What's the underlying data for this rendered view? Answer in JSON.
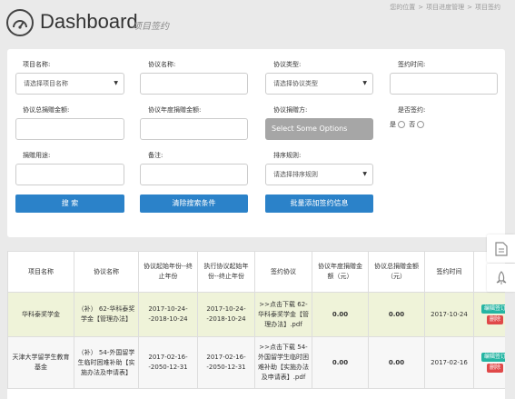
{
  "header": {
    "title": "Dashboard",
    "subtitle": "项目签约",
    "breadcrumb": [
      "您的位置",
      "项目进度管理",
      "项目签约"
    ]
  },
  "search": {
    "fields": {
      "project_name": {
        "label": "项目名称:",
        "placeholder": "请选择项目名称"
      },
      "agreement_name": {
        "label": "协议名称:",
        "value": ""
      },
      "agreement_type": {
        "label": "协议类型:",
        "placeholder": "请选择协议类型"
      },
      "sign_time": {
        "label": "签约时间:",
        "value": ""
      },
      "total_amount": {
        "label": "协议总捐赠金额:",
        "value": ""
      },
      "annual_amount": {
        "label": "协议年度捐赠金额:",
        "value": ""
      },
      "donor": {
        "label": "协议捐赠方:",
        "placeholder": "Select Some Options"
      },
      "signed": {
        "label": "是否签约:",
        "options": [
          "是",
          "否"
        ]
      },
      "usage": {
        "label": "捐赠用途:",
        "value": ""
      },
      "remark": {
        "label": "备注:",
        "value": ""
      },
      "sort_rule": {
        "label": "排序规则:",
        "placeholder": "请选择排序规则"
      }
    },
    "buttons": {
      "search": "搜 索",
      "clear": "清除搜索条件",
      "batch_add": "批量添加签约信息"
    }
  },
  "table": {
    "columns": [
      "项目名称",
      "协议名称",
      "协议起始年份--终止年份",
      "执行协议起始年份--终止年份",
      "签约协议",
      "协议年度捐赠金额（元）",
      "协议总捐赠金额（元）",
      "签约时间",
      "操作"
    ],
    "rows": [
      {
        "project": "华科泰奖学金",
        "agreement": "（补） 62-华科泰奖学金【管理办法】",
        "period": "2017-10-24--2018-10-24",
        "exec_period": "2017-10-24--2018-10-24",
        "file": ">>点击下载 62-华科泰奖学金【管理办法】.pdf",
        "annual": "0.00",
        "total": "0.00",
        "sign_date": "2017-10-24",
        "edit": "编辑签订",
        "delete": "删除"
      },
      {
        "project": "天津大学留学生教育基金",
        "agreement": "（补） 54-外国留学生临时困难补助【实施办法及申请表】",
        "period": "2017-02-16--2050-12-31",
        "exec_period": "2017-02-16--2050-12-31",
        "file": ">>点击下载 54-外国留学生临时困难补助【实施办法及申请表】.pdf",
        "annual": "0.00",
        "total": "0.00",
        "sign_date": "2017-02-16",
        "edit": "编辑签订",
        "delete": "删除"
      }
    ]
  },
  "side_tools": {
    "doc_icon": "document-icon",
    "top_icon": "rocket-icon"
  },
  "colors": {
    "primary": "#2b82c9",
    "edit": "#26b5a3",
    "delete": "#e04949",
    "row_highlight": "#eff3d9"
  }
}
